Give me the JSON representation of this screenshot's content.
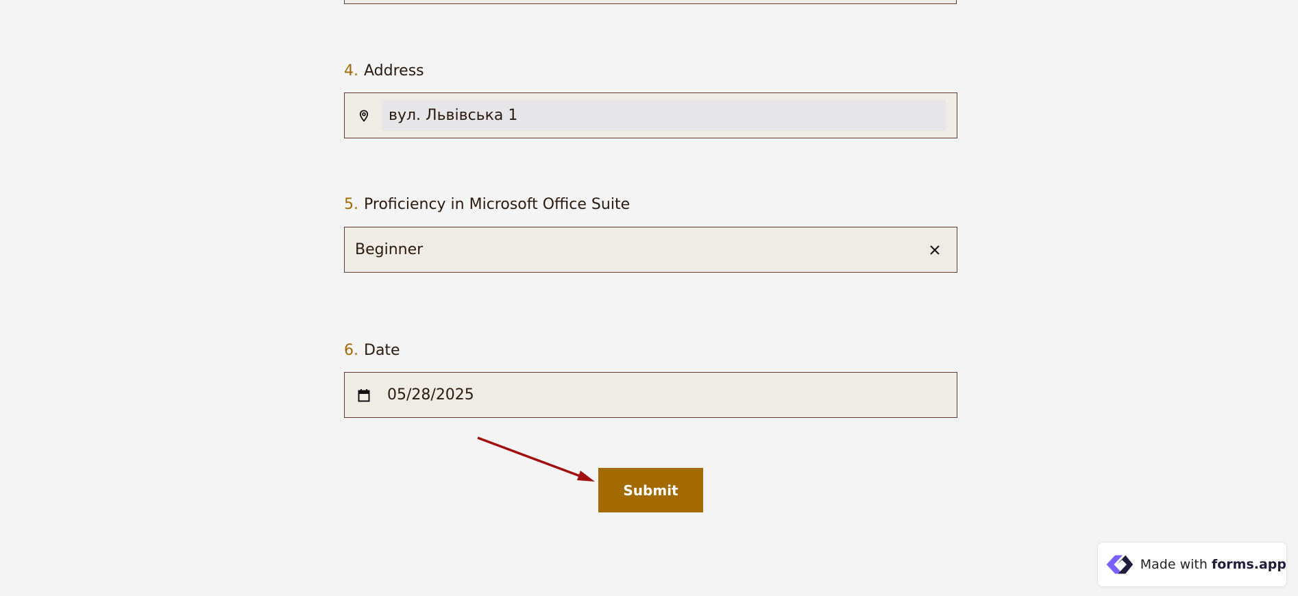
{
  "form": {
    "questions": [
      {
        "number": "4.",
        "label": "Address",
        "value": "вул. Львівська 1",
        "icon": "location-pin-icon"
      },
      {
        "number": "5.",
        "label": "Proficiency in Microsoft Office Suite",
        "value": "Beginner",
        "icon": "close-icon"
      },
      {
        "number": "6.",
        "label": "Date",
        "value": "05/28/2025",
        "icon": "calendar-icon"
      }
    ],
    "submit_label": "Submit"
  },
  "badge": {
    "prefix": "Made with ",
    "brand": "forms.app",
    "logo": "forms-app-logo-icon"
  },
  "colors": {
    "accent": "#a36a04",
    "field_bg": "#efebe5",
    "field_border": "#5a3a32",
    "page_bg": "#f4f4f4",
    "annotation_arrow": "#a01010"
  }
}
